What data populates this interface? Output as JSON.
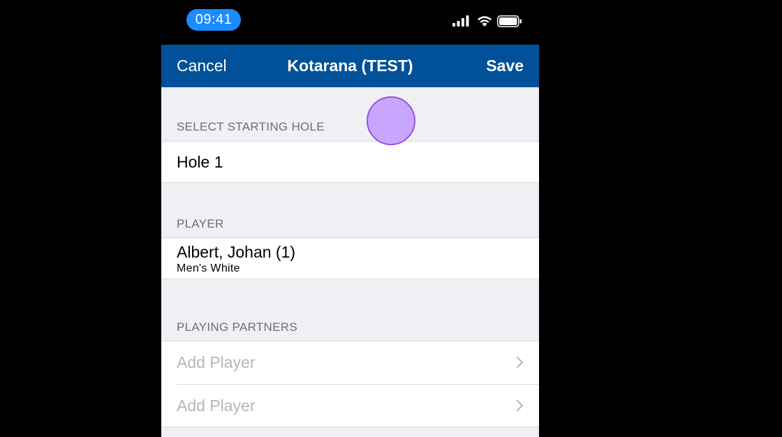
{
  "status_bar": {
    "time": "09:41",
    "icons": [
      "signal-icon",
      "wifi-icon",
      "battery-icon"
    ]
  },
  "navbar": {
    "cancel_label": "Cancel",
    "title": "Kotarana (TEST)",
    "save_label": "Save",
    "background_color": "#005199"
  },
  "starting_hole": {
    "header": "SELECT STARTING HOLE",
    "value": "Hole 1"
  },
  "player": {
    "header": "PLAYER",
    "name": "Albert, Johan (1)",
    "tee": "Men's White"
  },
  "playing_partners": {
    "header": "PLAYING PARTNERS",
    "items": [
      {
        "label": "Add Player",
        "icon": "chevron-right-icon"
      },
      {
        "label": "Add Player",
        "icon": "chevron-right-icon"
      }
    ]
  },
  "touch_indicator_color": "#c4a0ff"
}
